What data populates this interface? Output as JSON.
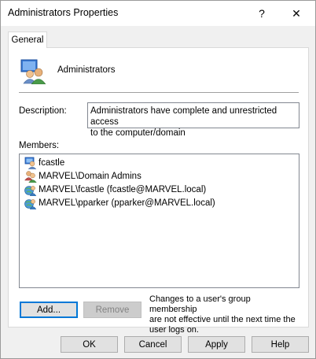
{
  "window": {
    "title": "Administrators Properties",
    "help_glyph": "?",
    "close_glyph": "✕"
  },
  "tabs": [
    {
      "label": "General",
      "selected": true
    }
  ],
  "group": {
    "name": "Administrators",
    "icon": "group-users-icon"
  },
  "description": {
    "label": "Description:",
    "value_line1": "Administrators have complete and unrestricted access",
    "value_line2": "to the computer/domain"
  },
  "members": {
    "label": "Members:",
    "items": [
      {
        "name": "fcastle",
        "icon": "local-user-icon"
      },
      {
        "name": "MARVEL\\Domain Admins",
        "icon": "domain-group-icon"
      },
      {
        "name": "MARVEL\\fcastle (fcastle@MARVEL.local)",
        "icon": "domain-user-icon"
      },
      {
        "name": "MARVEL\\pparker (pparker@MARVEL.local)",
        "icon": "domain-user-icon"
      }
    ]
  },
  "actions": {
    "add": "Add...",
    "remove": "Remove"
  },
  "note": {
    "line1": "Changes to a user's group membership",
    "line2": "are not effective until the next time the",
    "line3": "user logs on."
  },
  "footer": {
    "ok": "OK",
    "cancel": "Cancel",
    "apply": "Apply",
    "help": "Help"
  },
  "colors": {
    "accent": "#0078d7",
    "window_bg": "#f0f0f0",
    "panel_bg": "#ffffff"
  }
}
